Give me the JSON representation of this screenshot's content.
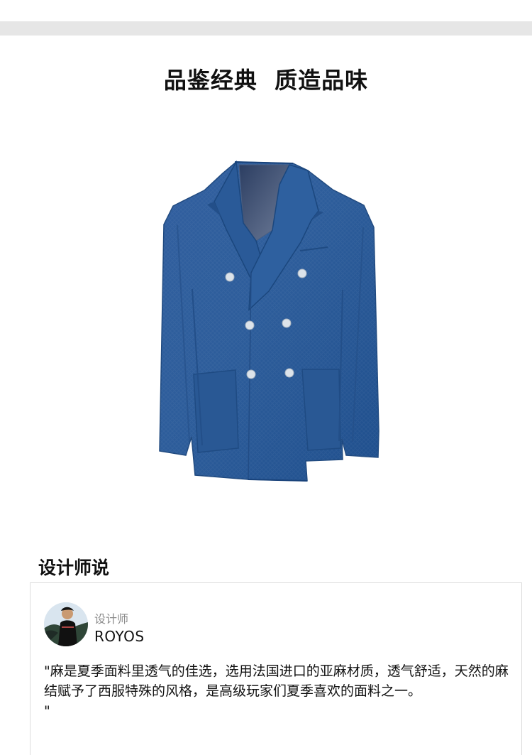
{
  "hero": {
    "title": "品鉴经典  质造品味"
  },
  "product": {
    "image_icon": "blue-double-breasted-linen-blazer",
    "fabric_color": "#2c5d9a",
    "button_color": "#dce3ea"
  },
  "designer_section": {
    "title": "设计师说",
    "role": "设计师",
    "name": "ROYOS",
    "avatar_icon": "designer-avatar",
    "quote": "\"麻是夏季面料里透气的佳选，选用法国进口的亚麻材质，透气舒适，天然的麻结赋予了西服特殊的风格，是高级玩家们夏季喜欢的面料之一。\n\""
  }
}
